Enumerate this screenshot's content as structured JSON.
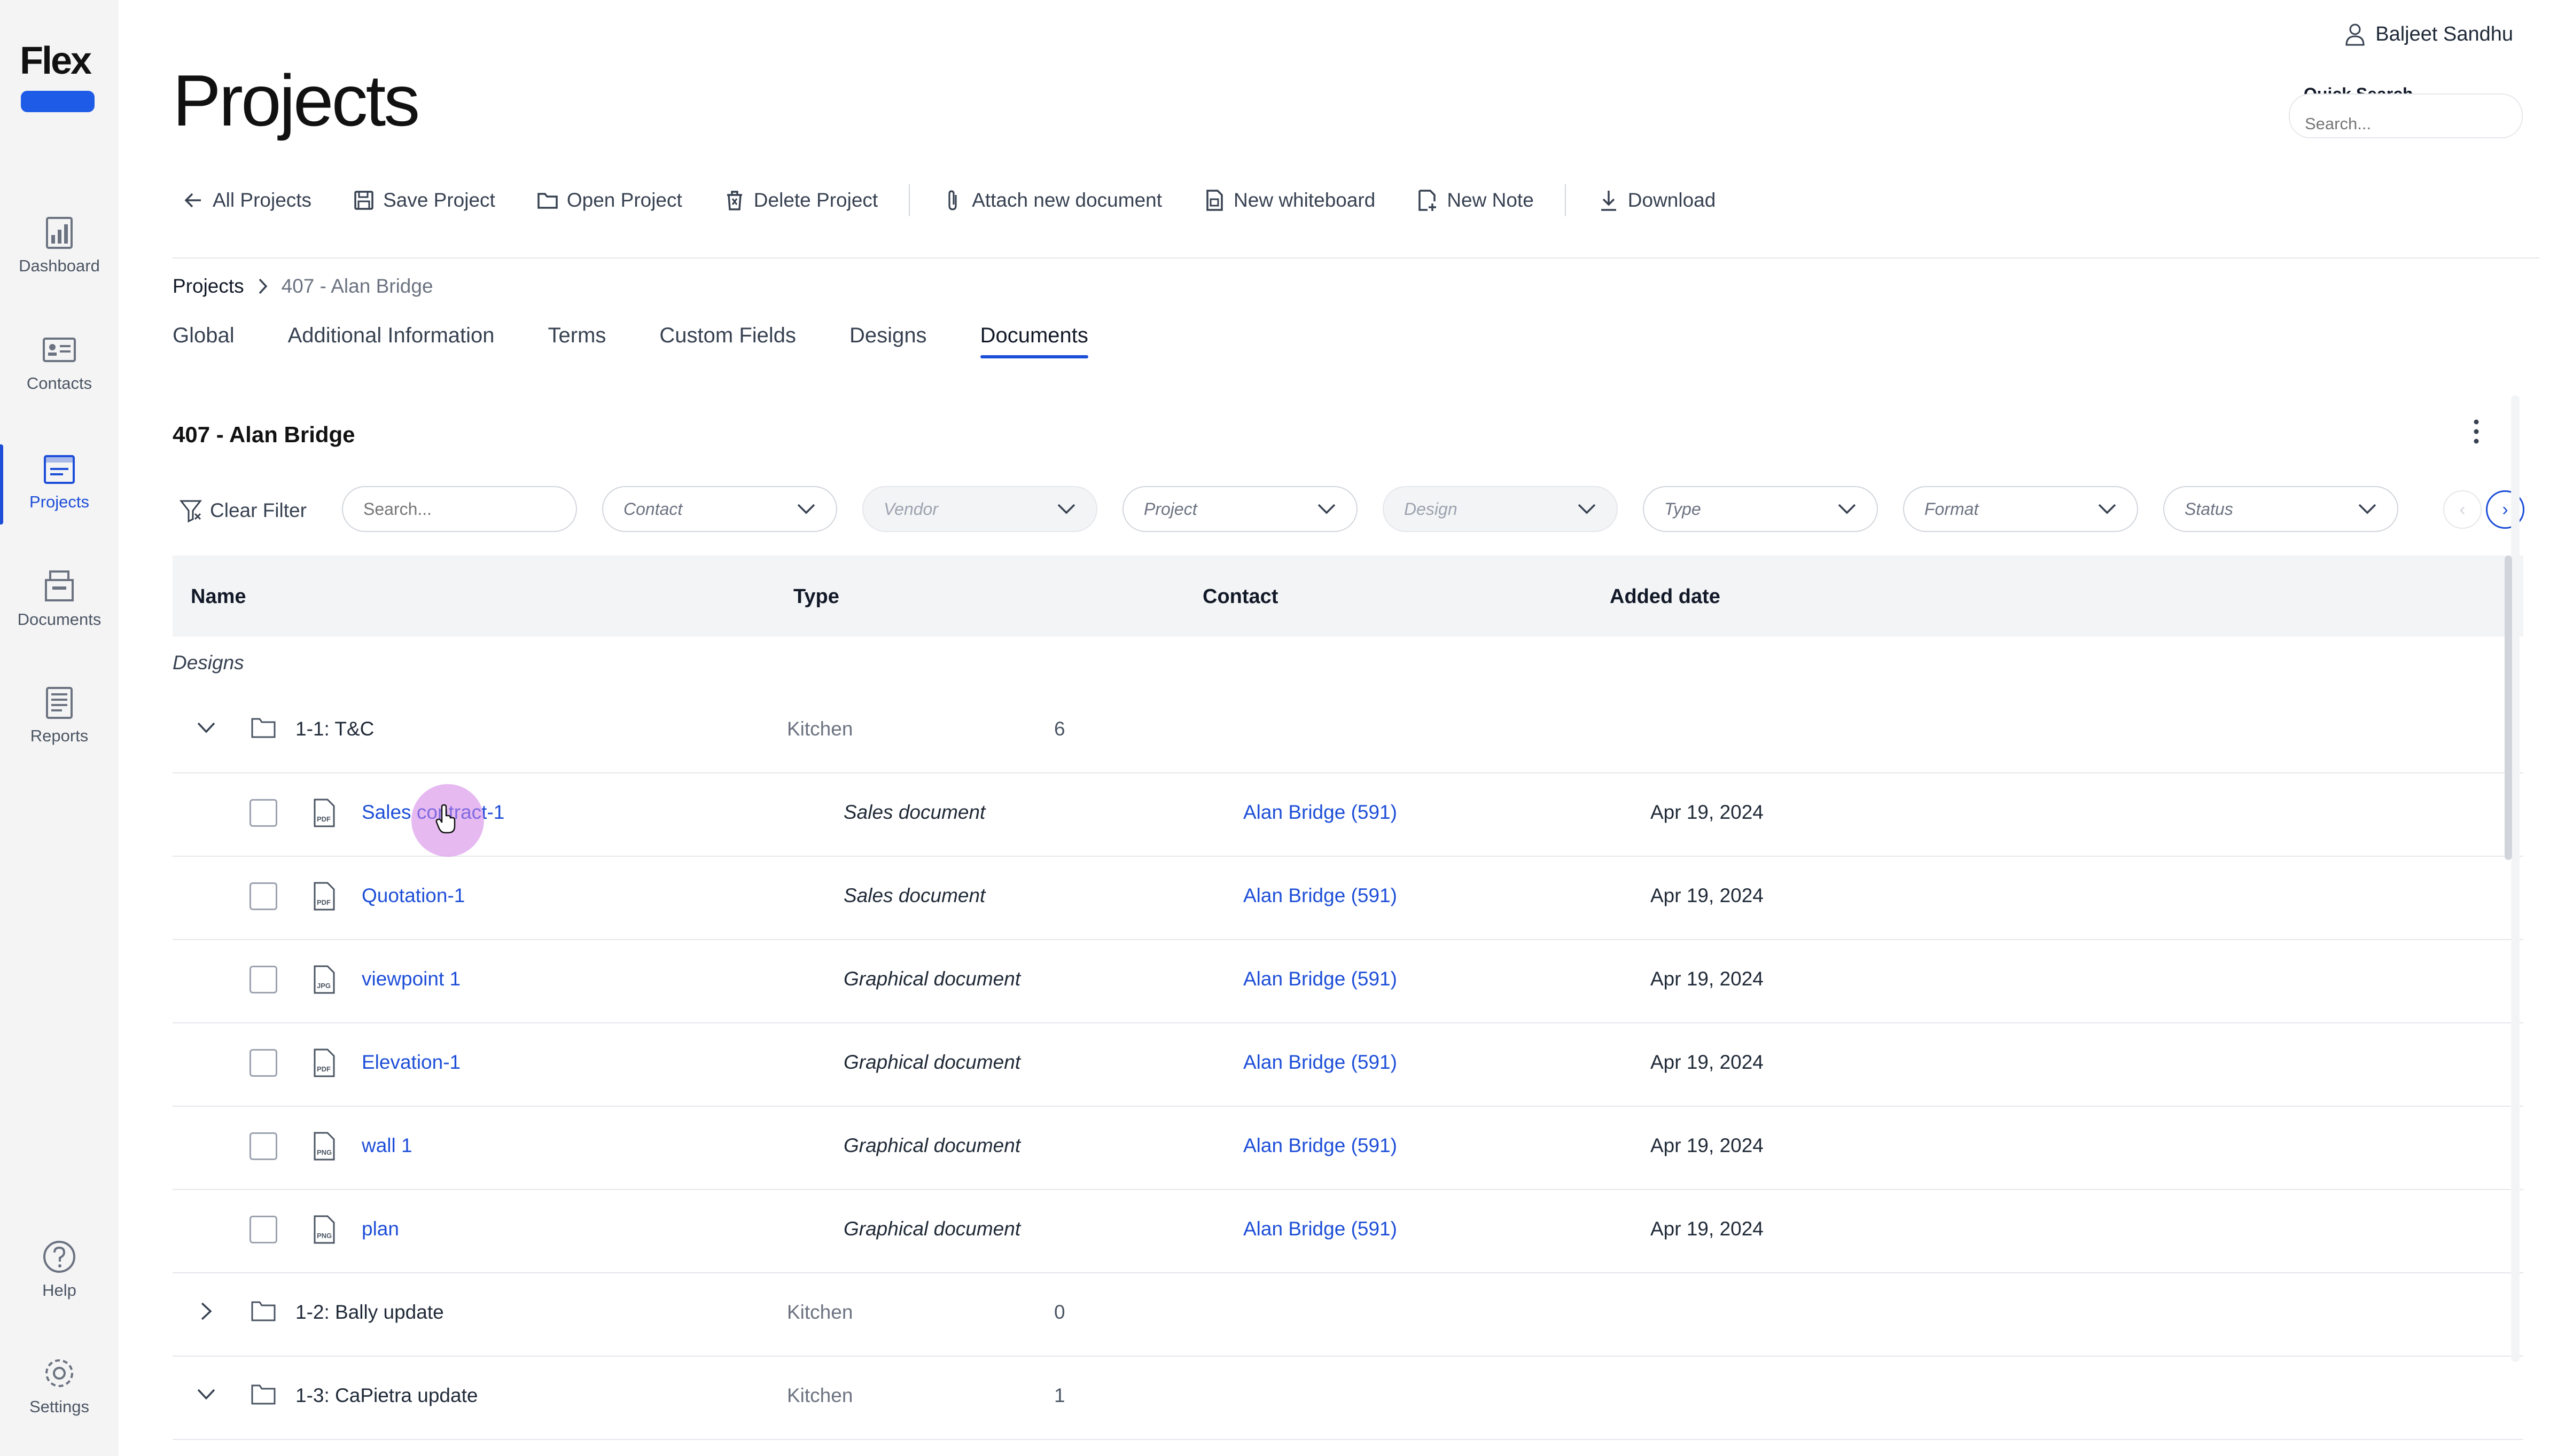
{
  "app": {
    "logo_text": "Flex",
    "user_name": "Baljeet Sandhu",
    "quick_search": {
      "label": "Quick Search",
      "placeholder": "Search..."
    }
  },
  "sidebar": {
    "items": [
      {
        "label": "Dashboard",
        "icon": "dashboard-icon"
      },
      {
        "label": "Contacts",
        "icon": "contacts-icon"
      },
      {
        "label": "Projects",
        "icon": "projects-icon",
        "active": true
      },
      {
        "label": "Documents",
        "icon": "documents-icon"
      },
      {
        "label": "Reports",
        "icon": "reports-icon"
      }
    ],
    "bottom_items": [
      {
        "label": "Help",
        "icon": "help-icon"
      },
      {
        "label": "Settings",
        "icon": "settings-icon"
      }
    ]
  },
  "header": {
    "title": "Projects",
    "toolbar": {
      "all_projects": "All Projects",
      "save_project": "Save Project",
      "open_project": "Open Project",
      "delete_project": "Delete Project",
      "attach_document": "Attach new document",
      "new_whiteboard": "New whiteboard",
      "new_note": "New Note",
      "download": "Download"
    }
  },
  "breadcrumb": {
    "root": "Projects",
    "current": "407 - Alan Bridge"
  },
  "tabs": [
    {
      "label": "Global"
    },
    {
      "label": "Additional Information"
    },
    {
      "label": "Terms"
    },
    {
      "label": "Custom Fields"
    },
    {
      "label": "Designs"
    },
    {
      "label": "Documents",
      "active": true
    }
  ],
  "section": {
    "title": "407 - Alan Bridge"
  },
  "filters": {
    "clear_label": "Clear Filter",
    "search_placeholder": "Search...",
    "dropdowns": [
      {
        "label": "Contact",
        "disabled": false
      },
      {
        "label": "Vendor",
        "disabled": true
      },
      {
        "label": "Project",
        "disabled": false
      },
      {
        "label": "Design",
        "disabled": true
      },
      {
        "label": "Type",
        "disabled": false
      },
      {
        "label": "Format",
        "disabled": false
      },
      {
        "label": "Status",
        "disabled": false
      }
    ],
    "prev": "‹",
    "next": "›"
  },
  "table": {
    "columns": {
      "name": "Name",
      "type": "Type",
      "contact": "Contact",
      "added": "Added date"
    },
    "group_label": "Designs",
    "folders": [
      {
        "name": "1-1: T&C",
        "type": "Kitchen",
        "count": "6",
        "expanded": true,
        "documents": [
          {
            "name": "Sales contract-1",
            "format": "PDF",
            "type": "Sales document",
            "contact": "Alan Bridge (591)",
            "date": "Apr 19, 2024"
          },
          {
            "name": "Quotation-1",
            "format": "PDF",
            "type": "Sales document",
            "contact": "Alan Bridge (591)",
            "date": "Apr 19, 2024"
          },
          {
            "name": "viewpoint 1",
            "format": "JPG",
            "type": "Graphical document",
            "contact": "Alan Bridge (591)",
            "date": "Apr 19, 2024"
          },
          {
            "name": "Elevation-1",
            "format": "PDF",
            "type": "Graphical document",
            "contact": "Alan Bridge (591)",
            "date": "Apr 19, 2024"
          },
          {
            "name": "wall 1",
            "format": "PNG",
            "type": "Graphical document",
            "contact": "Alan Bridge (591)",
            "date": "Apr 19, 2024"
          },
          {
            "name": "plan",
            "format": "PNG",
            "type": "Graphical document",
            "contact": "Alan Bridge (591)",
            "date": "Apr 19, 2024"
          }
        ]
      },
      {
        "name": "1-2: Bally update",
        "type": "Kitchen",
        "count": "0",
        "expanded": false,
        "documents": []
      },
      {
        "name": "1-3: CaPietra update",
        "type": "Kitchen",
        "count": "1",
        "expanded": true,
        "documents": []
      }
    ]
  },
  "colors": {
    "accent": "#1d4ed8",
    "logo_blue": "#1e5be6",
    "cursor_highlight": "#d98ae6"
  }
}
